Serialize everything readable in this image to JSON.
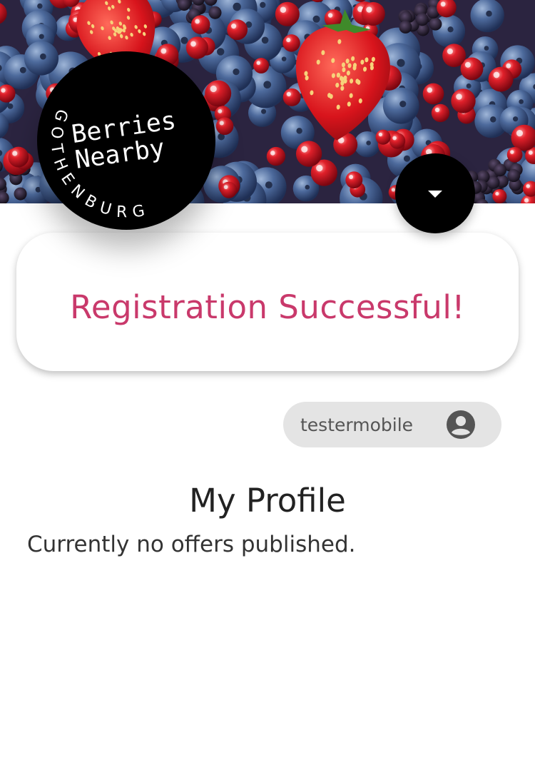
{
  "logo": {
    "line1": "Berries",
    "line2": "Nearby",
    "ring_text": "GOTHENBURG"
  },
  "menu_button": {
    "icon": "caret-down-icon"
  },
  "notification": {
    "message": "Registration Successful!",
    "color": "#c9396b"
  },
  "user": {
    "username": "testermobile",
    "icon": "account-circle-icon"
  },
  "profile": {
    "title": "My Profile",
    "empty_message": "Currently no offers published."
  }
}
